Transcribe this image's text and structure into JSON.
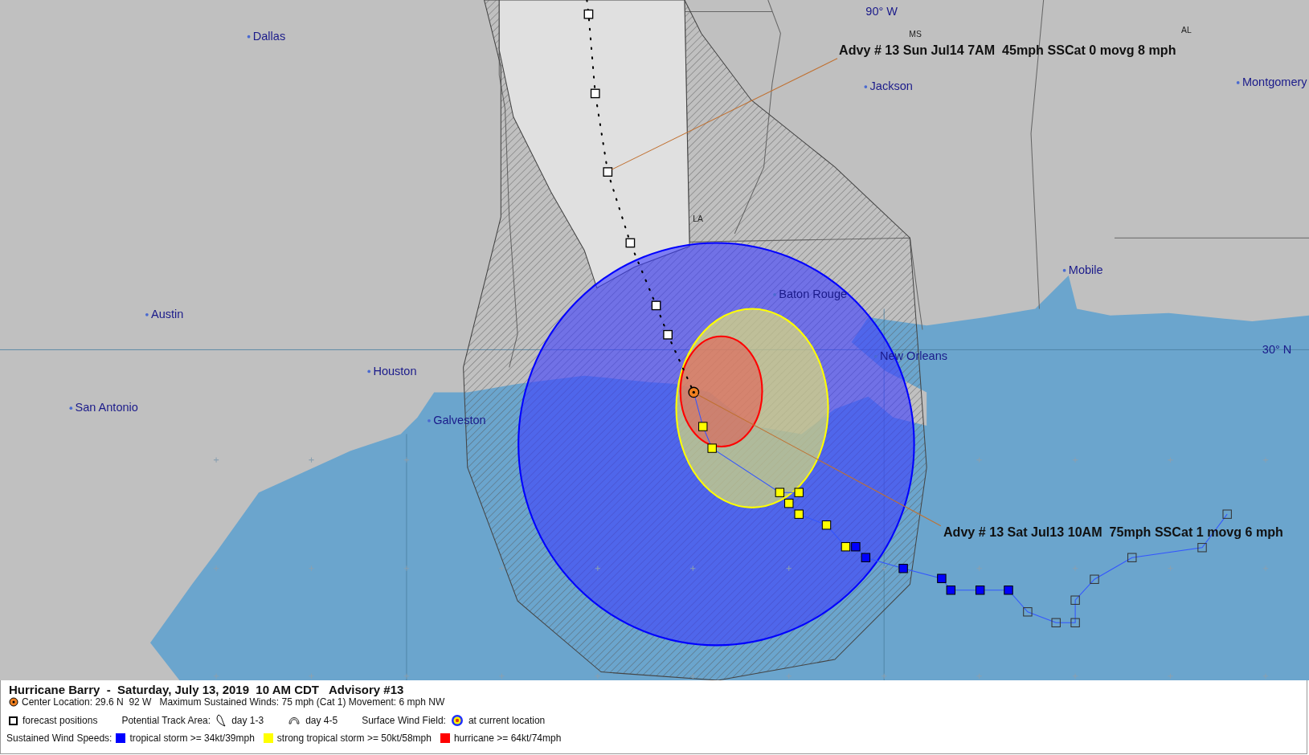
{
  "map": {
    "grid_labels": [
      "90° W",
      "30° N"
    ],
    "state_labels": [
      "MS",
      "AL",
      "LA"
    ],
    "cities": [
      {
        "name": "Dallas"
      },
      {
        "name": "Jackson"
      },
      {
        "name": "Montgomery"
      },
      {
        "name": "Austin"
      },
      {
        "name": "Houston"
      },
      {
        "name": "San Antonio"
      },
      {
        "name": "Galveston"
      },
      {
        "name": "Baton Rouge"
      },
      {
        "name": "New Orleans"
      },
      {
        "name": "Mobile"
      }
    ],
    "annotations": [
      "Advy # 13 Sun Jul14 7AM  45mph SSCat 0 movg 8 mph",
      "Advy # 13 Sat Jul13 10AM  75mph SSCat 1 movg 6 mph"
    ],
    "past_track": [
      {
        "color": "#ffff00"
      },
      {
        "color": "#ffff00"
      },
      {
        "color": "#ffff00"
      },
      {
        "color": "#ffff00"
      },
      {
        "color": "#ffff00"
      },
      {
        "color": "#ffff00"
      },
      {
        "color": "#ffff00"
      },
      {
        "color": "#ffff00"
      },
      {
        "color": "#0000ff"
      },
      {
        "color": "#0000ff"
      },
      {
        "color": "#0000ff"
      },
      {
        "color": "#0000ff"
      },
      {
        "color": "#0000ff"
      },
      {
        "color": "#0000ff"
      },
      {
        "color": "#0000ff"
      },
      {
        "kind": "hollow"
      },
      {
        "kind": "hollow"
      },
      {
        "kind": "hollow"
      },
      {
        "kind": "hollow"
      },
      {
        "kind": "hollow"
      },
      {
        "kind": "hollow"
      },
      {
        "kind": "hollow"
      },
      {
        "kind": "hollow"
      }
    ]
  },
  "legend": {
    "title": "Hurricane Barry  -  Saturday, July 13, 2019  10 AM CDT   Advisory #13",
    "center_info": "Center Location: 29.6 N  92 W   Maximum Sustained Winds: 75 mph (Cat 1) Movement: 6 mph NW",
    "forecast_label": "forecast positions",
    "track_area_label": "Potential Track Area:",
    "track_days": [
      "day 1-3",
      "day 4-5"
    ],
    "wind_field_label": "Surface Wind Field:",
    "wind_field_value": "at current location",
    "wind_speeds_label": "Sustained Wind Speeds:",
    "wind_speeds": [
      {
        "label": "tropical storm >= 34kt/39mph",
        "color": "#0000ff"
      },
      {
        "label": "strong tropical storm >= 50kt/58mph",
        "color": "#ffff00"
      },
      {
        "label": "hurricane >= 64kt/74mph",
        "color": "#ff0000"
      }
    ]
  }
}
